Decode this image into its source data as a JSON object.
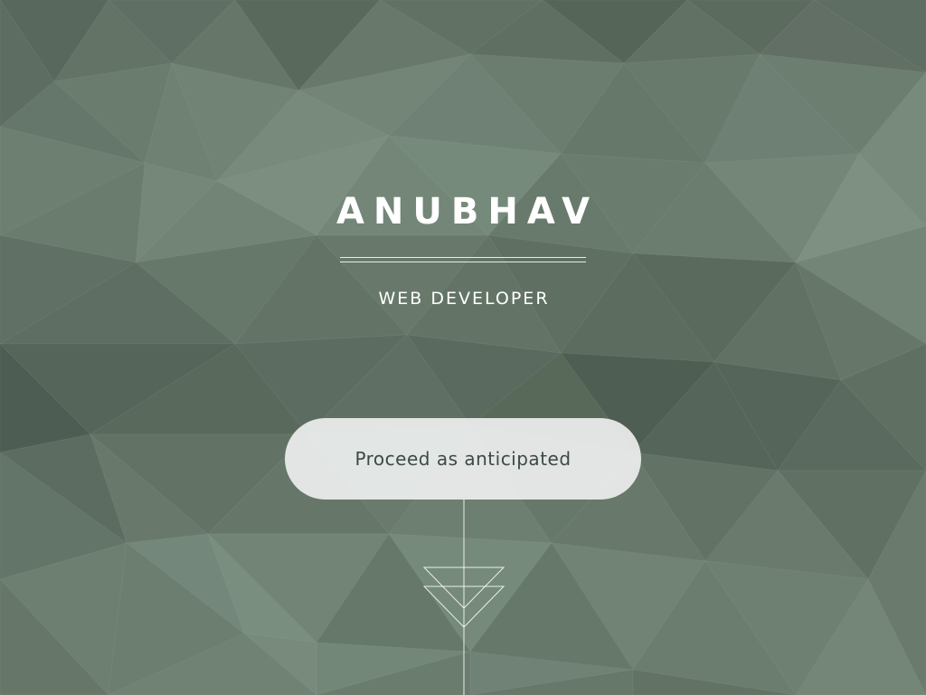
{
  "hero": {
    "name": "ANUBHAV",
    "role": "WEB DEVELOPER",
    "cta_label": "Proceed as anticipated"
  },
  "icons": {
    "scroll_indicator": "double-chevron-down-icon"
  },
  "colors": {
    "background": "#66786a",
    "background_dark": "#4f5d53",
    "background_light": "#7c8f80",
    "text": "#ffffff",
    "button_fill": "#eceeed",
    "button_text": "#3c4a44"
  }
}
